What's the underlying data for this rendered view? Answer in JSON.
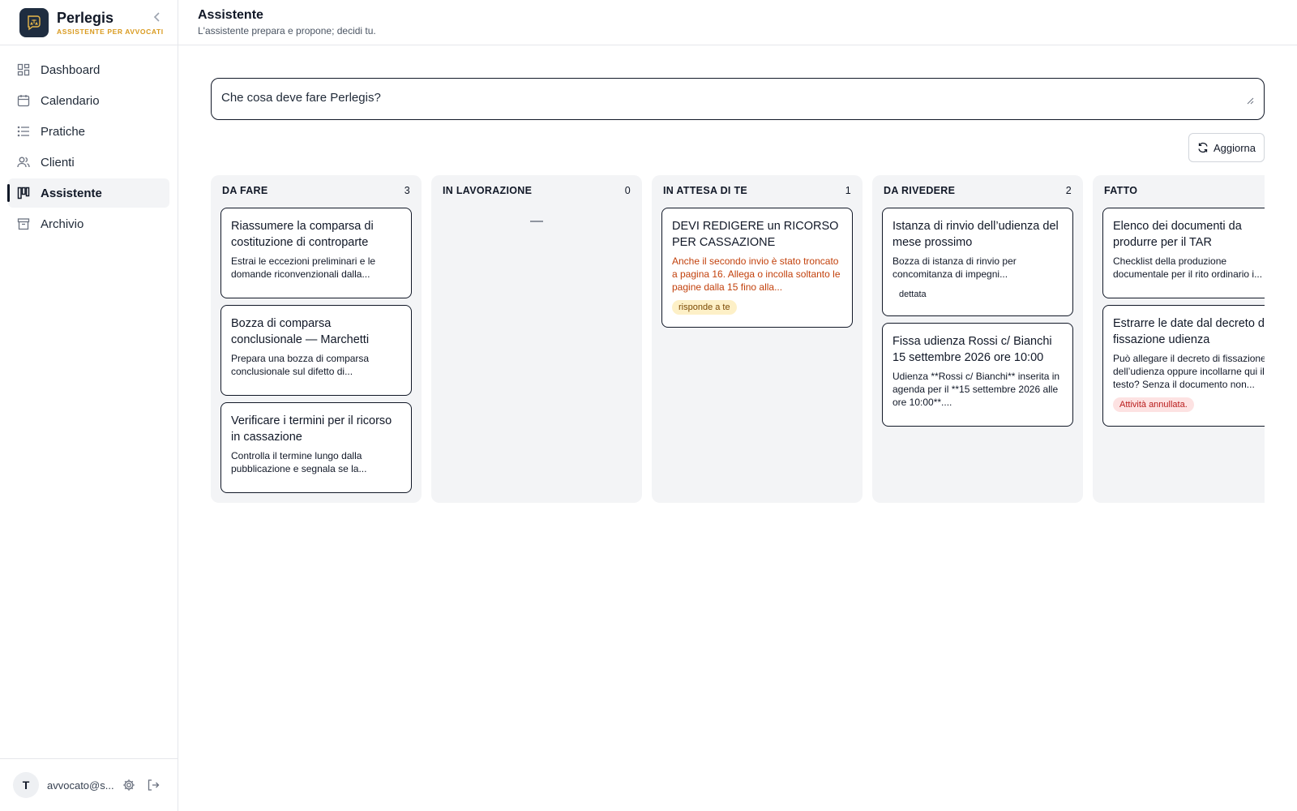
{
  "brand": {
    "name": "Perlegis",
    "subtitle": "ASSISTENTE PER AVVOCATI"
  },
  "nav": [
    {
      "label": "Dashboard",
      "icon": "dashboard-icon"
    },
    {
      "label": "Calendario",
      "icon": "calendar-icon"
    },
    {
      "label": "Pratiche",
      "icon": "list-icon"
    },
    {
      "label": "Clienti",
      "icon": "users-icon"
    },
    {
      "label": "Assistente",
      "icon": "kanban-icon",
      "active": true
    },
    {
      "label": "Archivio",
      "icon": "archive-icon"
    }
  ],
  "user": {
    "initial": "T",
    "email": "avvocato@s..."
  },
  "header": {
    "title": "Assistente",
    "subtitle": "L'assistente prepara e propone; decidi tu."
  },
  "prompt": {
    "placeholder": "Che cosa deve fare Perlegis?"
  },
  "refresh_label": "Aggiorna",
  "columns": [
    {
      "title": "DA FARE",
      "count": "3",
      "cards": [
        {
          "title": "Riassumere la comparsa di costituzione di controparte",
          "desc": "Estrai le eccezioni preliminari e le domande riconvenzionali dalla..."
        },
        {
          "title": "Bozza di comparsa conclusionale — Marchetti",
          "desc": "Prepara una bozza di comparsa conclusionale sul difetto di..."
        },
        {
          "title": "Verificare i termini per il ricorso in cassazione",
          "desc": "Controlla il termine lungo dalla pubblicazione e segnala se la..."
        }
      ]
    },
    {
      "title": "IN LAVORAZIONE",
      "count": "0",
      "empty": "—",
      "cards": []
    },
    {
      "title": "IN ATTESA DI TE",
      "count": "1",
      "cards": [
        {
          "title": "DEVI REDIGERE un RICORSO PER CASSAZIONE",
          "desc": "Anche il secondo invio è stato troncato a pagina 16. Allega o incolla soltanto le pagine dalla 15 fino alla...",
          "badge": "risponde a te"
        }
      ]
    },
    {
      "title": "DA RIVEDERE",
      "count": "2",
      "cards": [
        {
          "title": "Istanza di rinvio dell’udienza del mese prossimo",
          "desc": "Bozza di istanza di rinvio per concomitanza di impegni...",
          "badge": "dettata"
        },
        {
          "title": "Fissa udienza Rossi c/ Bianchi 15 settembre 2026 ore 10:00",
          "desc": "Udienza **Rossi c/ Bianchi** inserita in agenda per il **15 settembre 2026 alle ore 10:00**...."
        }
      ]
    },
    {
      "title": "FATTO",
      "count": "",
      "cards": [
        {
          "title": "Elenco dei documenti da produrre per il TAR",
          "desc": "Checklist della produzione documentale per il rito ordinario i..."
        },
        {
          "title": "Estrarre le date dal decreto di fissazione udienza",
          "desc": "Può allegare il decreto di fissazione dell’udienza oppure incollarne qui il testo? Senza il documento non...",
          "badge": "Attività annullata."
        }
      ]
    }
  ],
  "colors": {
    "accent": "#d99a1e",
    "logo_bg": "#1f2d40",
    "warn_text": "#c2410c",
    "badge_yellow": "#fdf0c7",
    "badge_red": "#fde2e2"
  }
}
